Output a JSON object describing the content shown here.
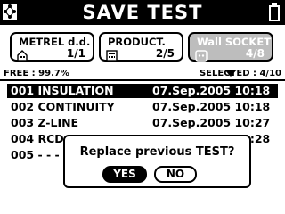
{
  "header": {
    "title": "SAVE TEST",
    "left_icon": "network-icon",
    "right_icon": "battery-icon"
  },
  "tabs": [
    {
      "label": "METREL d.d.",
      "count": "1/1",
      "icon": "building-icon",
      "active": true
    },
    {
      "label": "PRODUCT.",
      "count": "2/5",
      "icon": "device-icon",
      "active": true
    },
    {
      "label": "Wall SOCKET",
      "count": "4/8",
      "icon": "socket-icon",
      "active": false
    }
  ],
  "stats": {
    "free": "FREE : 99.7%",
    "selected": "SELECTED : 4/10"
  },
  "rows": [
    {
      "name": "001 INSULATION",
      "date": "07.Sep.2005 10:18",
      "selected": true
    },
    {
      "name": "002 CONTINUITY",
      "date": "07.Sep.2005 10:18",
      "selected": false
    },
    {
      "name": "003 Z-LINE",
      "date": "07.Sep.2005 10:27",
      "selected": false
    },
    {
      "name": "004 RCD",
      "date": "07.Sep.2005 10:28",
      "selected": false
    },
    {
      "name": "005 - - - -",
      "date": "",
      "selected": false
    }
  ],
  "dialog": {
    "question": "Replace previous TEST?",
    "yes_label": "YES",
    "no_label": "NO"
  },
  "colors": {
    "foreground": "#000000",
    "background": "#ffffff",
    "inactive_tab": "#bdbdbd"
  }
}
